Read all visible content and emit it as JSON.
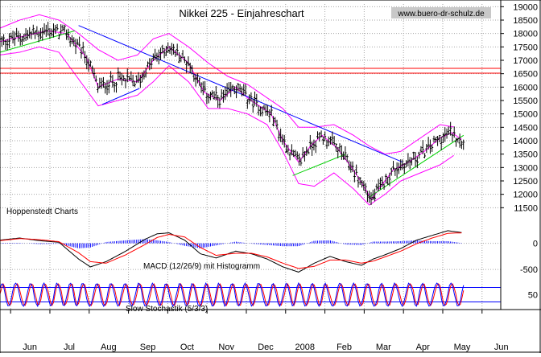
{
  "colors": {
    "grid": "#a6a6a6",
    "price_bars": "#000000",
    "bollinger": "#ff00ff",
    "trendline": "#0000ff",
    "support": "#00d000",
    "resistance": "#ff0000",
    "macd_line": "#000000",
    "signal_line": "#ff0000",
    "histogram": "#0000ff",
    "stoch_k": "#0000ff",
    "stoch_d": "#ff0000",
    "stoch_band": "#0000ff"
  },
  "chart_data": [
    {
      "type": "bar",
      "subtype": "ohlc",
      "title": "Nikkei 225 - Einjahreschart",
      "watermark": "www.buero-dr-schulz.de",
      "annotation": "Hoppenstedt Charts",
      "ylim": [
        11150,
        19100
      ],
      "y_ticks": [
        "19000",
        "18500",
        "18000",
        "17500",
        "17000",
        "16500",
        "16000",
        "15500",
        "15000",
        "14500",
        "14000",
        "13500",
        "13000",
        "12500",
        "12000",
        "11500"
      ],
      "x_ticks": [
        "Jun",
        "Jul",
        "Aug",
        "Sep",
        "Oct",
        "Nov",
        "Dec",
        "2008",
        "Feb",
        "Mar",
        "Apr",
        "May",
        "Jun"
      ],
      "x_tick_positions": [
        0.27,
        1.27,
        2.27,
        3.27,
        4.27,
        5.27,
        6.27,
        7.27,
        8.27,
        9.27,
        10.27,
        11.27,
        12.27
      ],
      "grid": true,
      "close_approx": {
        "t": [
          0,
          1.2,
          1.7,
          2.2,
          2.5,
          3.0,
          3.5,
          3.9,
          4.3,
          4.8,
          5.2,
          5.6,
          6.0,
          6.3,
          6.7,
          6.9,
          7.2,
          7.6,
          7.9,
          8.2,
          8.6,
          9.0,
          9.3,
          9.45,
          9.7,
          10.0,
          10.4,
          10.8,
          11.2,
          11.5,
          11.8
        ],
        "values": [
          17700,
          18100,
          18000,
          17100,
          16000,
          16300,
          16200,
          17000,
          17500,
          16900,
          15800,
          15500,
          16000,
          15600,
          15200,
          15000,
          14000,
          13200,
          13800,
          14200,
          13700,
          12900,
          12200,
          11800,
          12300,
          12900,
          13200,
          13600,
          14100,
          14300,
          14000
        ]
      },
      "horizontal_lines": [
        {
          "color": "red",
          "value": 16700
        },
        {
          "color": "red",
          "value": 16520
        }
      ],
      "trendlines": [
        {
          "color": "blue",
          "from": [
            2.0,
            18300
          ],
          "to": [
            10.25,
            13200
          ]
        },
        {
          "color": "blue",
          "from": [
            2.6,
            15350
          ],
          "to": [
            3.55,
            15950
          ]
        },
        {
          "color": "green",
          "from": [
            7.45,
            12700
          ],
          "to": [
            8.8,
            13500
          ]
        },
        {
          "color": "green",
          "from": [
            9.4,
            11900
          ],
          "to": [
            11.8,
            14200
          ]
        },
        {
          "color": "green",
          "from": [
            0,
            17300
          ],
          "to": [
            1.9,
            18100
          ]
        }
      ],
      "bollinger_upper": {
        "t": [
          0,
          0.5,
          1.0,
          1.5,
          2.0,
          2.5,
          3.0,
          3.5,
          3.9,
          4.3,
          4.8,
          5.3,
          5.8,
          6.3,
          6.8,
          7.2,
          7.6,
          8.0,
          8.5,
          9.0,
          9.4,
          9.8,
          10.2,
          10.7,
          11.2,
          11.6
        ],
        "values": [
          18200,
          18500,
          18700,
          18500,
          18000,
          17400,
          17000,
          17200,
          17800,
          18000,
          17500,
          16900,
          16400,
          16100,
          15600,
          15200,
          14500,
          14500,
          14600,
          14200,
          13800,
          13500,
          13600,
          14100,
          14600,
          14500
        ]
      },
      "bollinger_lower": {
        "t": [
          0,
          0.5,
          1.0,
          1.5,
          2.0,
          2.5,
          3.0,
          3.5,
          3.9,
          4.3,
          4.8,
          5.3,
          5.8,
          6.3,
          6.8,
          7.2,
          7.6,
          8.0,
          8.5,
          9.0,
          9.4,
          9.8,
          10.2,
          10.7,
          11.2,
          11.6
        ],
        "values": [
          17200,
          17300,
          17500,
          17300,
          16300,
          15300,
          15500,
          15700,
          16200,
          16800,
          16200,
          15200,
          15200,
          15000,
          14600,
          13600,
          12400,
          12300,
          12800,
          12200,
          11600,
          12000,
          12500,
          12800,
          13100,
          13500
        ]
      }
    },
    {
      "type": "line",
      "subtype": "macd_histogram",
      "label": "MACD (12/26/9) mit Histogramm",
      "y_ticks": [
        "0",
        "-500"
      ],
      "y_tick_values": [
        0,
        -500
      ],
      "ylim": [
        -620,
        300
      ],
      "macd": {
        "t": [
          0,
          0.5,
          1.0,
          1.5,
          2.0,
          2.3,
          2.7,
          3.2,
          3.7,
          4.0,
          4.3,
          4.7,
          5.1,
          5.5,
          6.0,
          6.4,
          6.8,
          7.2,
          7.6,
          8.0,
          8.4,
          8.8,
          9.2,
          9.5,
          9.8,
          10.2,
          10.6,
          11.0,
          11.4,
          11.8
        ],
        "values": [
          60,
          100,
          50,
          20,
          -300,
          -450,
          -350,
          -150,
          80,
          180,
          200,
          60,
          -200,
          -280,
          -150,
          -200,
          -300,
          -450,
          -550,
          -380,
          -250,
          -350,
          -420,
          -300,
          -220,
          -100,
          60,
          150,
          240,
          200
        ]
      },
      "signal": {
        "t": [
          0,
          0.5,
          1.0,
          1.5,
          2.0,
          2.3,
          2.7,
          3.2,
          3.7,
          4.0,
          4.3,
          4.7,
          5.1,
          5.5,
          6.0,
          6.4,
          6.8,
          7.2,
          7.6,
          8.0,
          8.4,
          8.8,
          9.2,
          9.5,
          9.8,
          10.2,
          10.6,
          11.0,
          11.4,
          11.8
        ],
        "values": [
          50,
          90,
          70,
          30,
          -180,
          -350,
          -380,
          -220,
          -20,
          110,
          170,
          120,
          -80,
          -230,
          -190,
          -190,
          -260,
          -380,
          -480,
          -440,
          -320,
          -320,
          -380,
          -340,
          -260,
          -150,
          -10,
          100,
          190,
          200
        ]
      }
    },
    {
      "type": "line",
      "subtype": "stochastic",
      "label": "Slow Stochastik (5/3/3)",
      "y_ticks": [
        "50"
      ],
      "y_tick_values": [
        50
      ],
      "ylim": [
        -5,
        105
      ],
      "bands": [
        20,
        80
      ]
    }
  ]
}
